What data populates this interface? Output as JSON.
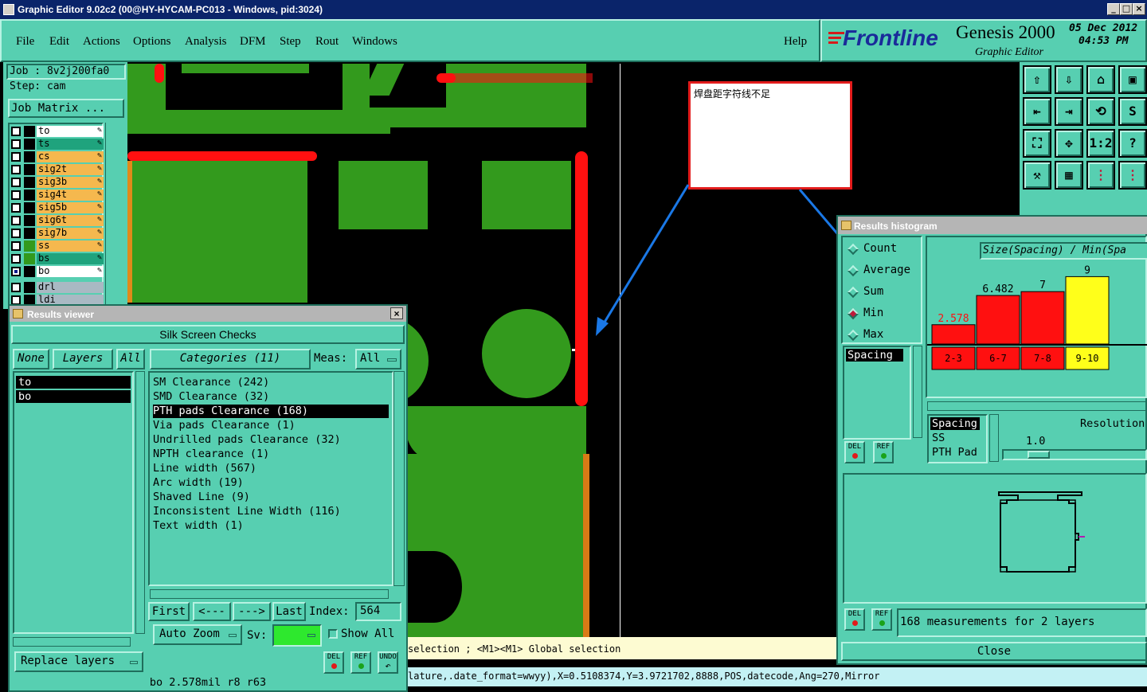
{
  "window": {
    "title": "Graphic Editor 9.02c2 (00@HY-HYCAM-PC013 - Windows, pid:3024)",
    "buttons": [
      "_",
      "□",
      "×"
    ]
  },
  "menu": {
    "items": [
      "File",
      "Edit",
      "Actions",
      "Options",
      "Analysis",
      "DFM",
      "Step",
      "Rout",
      "Windows"
    ],
    "help": "Help"
  },
  "logo": {
    "brand": "Frontline",
    "product": "Genesis 2000",
    "subtitle": "Graphic Editor",
    "date": "05 Dec 2012",
    "time": "04:53 PM"
  },
  "job": {
    "job": "Job : 8v2j200fa0",
    "step": "Step: cam",
    "matrix_button": "Job Matrix ..."
  },
  "layers": [
    {
      "name": "to",
      "color": "#ffffff"
    },
    {
      "name": "ts",
      "color": "#1fa37d"
    },
    {
      "name": "cs",
      "color": "#f5b84e"
    },
    {
      "name": "sig2t",
      "color": "#f5b84e"
    },
    {
      "name": "sig3b",
      "color": "#f5b84e"
    },
    {
      "name": "sig4t",
      "color": "#f5b84e"
    },
    {
      "name": "sig5b",
      "color": "#f5b84e"
    },
    {
      "name": "sig6t",
      "color": "#f5b84e"
    },
    {
      "name": "sig7b",
      "color": "#f5b84e"
    },
    {
      "name": "ss",
      "color": "#f5b84e"
    },
    {
      "name": "bs",
      "color": "#1fa37d"
    },
    {
      "name": "bo",
      "color": "#ffffff"
    },
    {
      "name": "drl",
      "color": "#a9b9c3"
    },
    {
      "name": "ldi",
      "color": "#a9b9c3"
    }
  ],
  "annotation": {
    "text": "焊盘距字符线不足"
  },
  "results_viewer": {
    "title": "Results viewer",
    "close": "×",
    "header": "Silk Screen Checks",
    "none_btn": "None",
    "layers_btn": "Layers",
    "all_btn": "All",
    "categories_btn": "Categories (11)",
    "meas_label": "Meas:",
    "meas_value": "All",
    "layer_list": [
      "to",
      "bo"
    ],
    "categories": [
      "SM Clearance (242)",
      "SMD Clearance (32)",
      "PTH pads Clearance (168)",
      "Via pads Clearance (1)",
      "Undrilled pads Clearance (32)",
      "NPTH clearance (1)",
      "Line width (567)",
      "Arc width (19)",
      "Shaved Line (9)",
      "Inconsistent Line Width (116)",
      "Text width (1)"
    ],
    "first": "First",
    "prev": "<---",
    "next": "--->",
    "last": "Last",
    "index_label": "Index:",
    "index_value": "564",
    "auto_zoom": "Auto Zoom",
    "sv_label": "Sv:",
    "show_all": "Show All",
    "replace_layers": "Replace layers",
    "del": "DEL",
    "ref": "REF",
    "undo": "UNDO",
    "statusline": "bo 2.578mil   r8   r63"
  },
  "histogram": {
    "title": "Results histogram",
    "modes": [
      "Count",
      "Average",
      "Sum",
      "Min",
      "Max"
    ],
    "selected_mode": "Min",
    "chart_title": "Size(Spacing) / Min(Spa",
    "type_list_top": "Spacing",
    "type_list": [
      "Spacing",
      "SS",
      "PTH Pad"
    ],
    "resolution_label": "Resolution",
    "resolution_value": "1.0",
    "measurements": "168 measurements for 2 layers",
    "close": "Close",
    "del": "DEL",
    "ref": "REF"
  },
  "chart_data": {
    "type": "bar",
    "title": "Size(Spacing) / Min(Spa",
    "categories": [
      "2-3",
      "6-7",
      "7-8",
      "9-10"
    ],
    "values": [
      2.578,
      6.482,
      7,
      9
    ],
    "value_labels": [
      "2.578",
      "6.482",
      "7",
      "9"
    ],
    "colors": [
      "#ff1010",
      "#ff1010",
      "#ff1010",
      "#ffff1a"
    ],
    "ylim": [
      0,
      10
    ]
  },
  "status": {
    "selection": "selection ; <M1><M1> Global selection",
    "command": "lature,.date_format=wwyy),X=0.5108374,Y=3.9721702,8888,POS,datecode,Ang=270,Mirror"
  },
  "toolbar_icons": [
    "zoom-home-icon",
    "zoom-out-icon",
    "home-icon",
    "window-icon",
    "pan-left-icon",
    "pan-right-icon",
    "redraw-icon",
    "snake-icon",
    "fit-icon",
    "center-icon",
    "ratio-icon",
    "help-icon",
    "measure-icon",
    "grid-icon",
    "layer-compare-icon",
    "layer-compare-2-icon"
  ],
  "toolbar_labels": [
    "⇧",
    "⇩",
    "⌂",
    "▣",
    "⇤",
    "⇥",
    "⟲",
    "S",
    "⛶",
    "✥",
    "1:2",
    "?",
    "⚒",
    "▦",
    "⋮",
    "⋮"
  ]
}
